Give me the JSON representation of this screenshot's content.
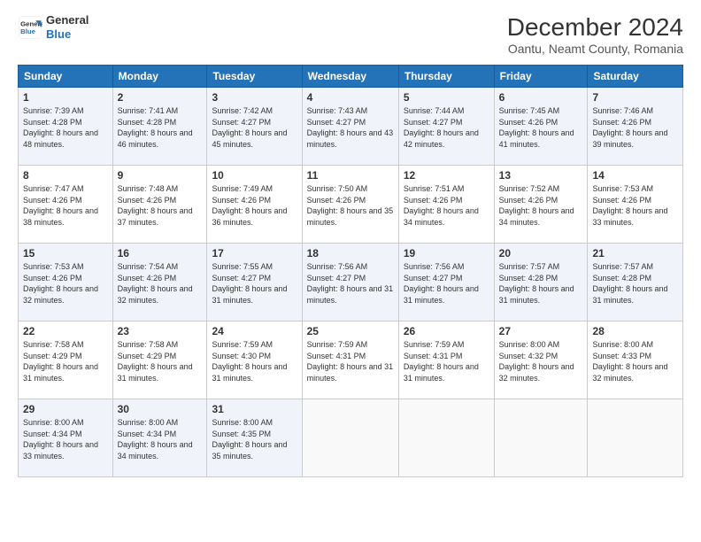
{
  "header": {
    "logo_line1": "General",
    "logo_line2": "Blue",
    "main_title": "December 2024",
    "subtitle": "Oantu, Neamt County, Romania"
  },
  "days_of_week": [
    "Sunday",
    "Monday",
    "Tuesday",
    "Wednesday",
    "Thursday",
    "Friday",
    "Saturday"
  ],
  "weeks": [
    [
      {
        "day": "1",
        "sunrise": "7:39 AM",
        "sunset": "4:28 PM",
        "daylight": "8 hours and 48 minutes."
      },
      {
        "day": "2",
        "sunrise": "7:41 AM",
        "sunset": "4:28 PM",
        "daylight": "8 hours and 46 minutes."
      },
      {
        "day": "3",
        "sunrise": "7:42 AM",
        "sunset": "4:27 PM",
        "daylight": "8 hours and 45 minutes."
      },
      {
        "day": "4",
        "sunrise": "7:43 AM",
        "sunset": "4:27 PM",
        "daylight": "8 hours and 43 minutes."
      },
      {
        "day": "5",
        "sunrise": "7:44 AM",
        "sunset": "4:27 PM",
        "daylight": "8 hours and 42 minutes."
      },
      {
        "day": "6",
        "sunrise": "7:45 AM",
        "sunset": "4:26 PM",
        "daylight": "8 hours and 41 minutes."
      },
      {
        "day": "7",
        "sunrise": "7:46 AM",
        "sunset": "4:26 PM",
        "daylight": "8 hours and 39 minutes."
      }
    ],
    [
      {
        "day": "8",
        "sunrise": "7:47 AM",
        "sunset": "4:26 PM",
        "daylight": "8 hours and 38 minutes."
      },
      {
        "day": "9",
        "sunrise": "7:48 AM",
        "sunset": "4:26 PM",
        "daylight": "8 hours and 37 minutes."
      },
      {
        "day": "10",
        "sunrise": "7:49 AM",
        "sunset": "4:26 PM",
        "daylight": "8 hours and 36 minutes."
      },
      {
        "day": "11",
        "sunrise": "7:50 AM",
        "sunset": "4:26 PM",
        "daylight": "8 hours and 35 minutes."
      },
      {
        "day": "12",
        "sunrise": "7:51 AM",
        "sunset": "4:26 PM",
        "daylight": "8 hours and 34 minutes."
      },
      {
        "day": "13",
        "sunrise": "7:52 AM",
        "sunset": "4:26 PM",
        "daylight": "8 hours and 34 minutes."
      },
      {
        "day": "14",
        "sunrise": "7:53 AM",
        "sunset": "4:26 PM",
        "daylight": "8 hours and 33 minutes."
      }
    ],
    [
      {
        "day": "15",
        "sunrise": "7:53 AM",
        "sunset": "4:26 PM",
        "daylight": "8 hours and 32 minutes."
      },
      {
        "day": "16",
        "sunrise": "7:54 AM",
        "sunset": "4:26 PM",
        "daylight": "8 hours and 32 minutes."
      },
      {
        "day": "17",
        "sunrise": "7:55 AM",
        "sunset": "4:27 PM",
        "daylight": "8 hours and 31 minutes."
      },
      {
        "day": "18",
        "sunrise": "7:56 AM",
        "sunset": "4:27 PM",
        "daylight": "8 hours and 31 minutes."
      },
      {
        "day": "19",
        "sunrise": "7:56 AM",
        "sunset": "4:27 PM",
        "daylight": "8 hours and 31 minutes."
      },
      {
        "day": "20",
        "sunrise": "7:57 AM",
        "sunset": "4:28 PM",
        "daylight": "8 hours and 31 minutes."
      },
      {
        "day": "21",
        "sunrise": "7:57 AM",
        "sunset": "4:28 PM",
        "daylight": "8 hours and 31 minutes."
      }
    ],
    [
      {
        "day": "22",
        "sunrise": "7:58 AM",
        "sunset": "4:29 PM",
        "daylight": "8 hours and 31 minutes."
      },
      {
        "day": "23",
        "sunrise": "7:58 AM",
        "sunset": "4:29 PM",
        "daylight": "8 hours and 31 minutes."
      },
      {
        "day": "24",
        "sunrise": "7:59 AM",
        "sunset": "4:30 PM",
        "daylight": "8 hours and 31 minutes."
      },
      {
        "day": "25",
        "sunrise": "7:59 AM",
        "sunset": "4:31 PM",
        "daylight": "8 hours and 31 minutes."
      },
      {
        "day": "26",
        "sunrise": "7:59 AM",
        "sunset": "4:31 PM",
        "daylight": "8 hours and 31 minutes."
      },
      {
        "day": "27",
        "sunrise": "8:00 AM",
        "sunset": "4:32 PM",
        "daylight": "8 hours and 32 minutes."
      },
      {
        "day": "28",
        "sunrise": "8:00 AM",
        "sunset": "4:33 PM",
        "daylight": "8 hours and 32 minutes."
      }
    ],
    [
      {
        "day": "29",
        "sunrise": "8:00 AM",
        "sunset": "4:34 PM",
        "daylight": "8 hours and 33 minutes."
      },
      {
        "day": "30",
        "sunrise": "8:00 AM",
        "sunset": "4:34 PM",
        "daylight": "8 hours and 34 minutes."
      },
      {
        "day": "31",
        "sunrise": "8:00 AM",
        "sunset": "4:35 PM",
        "daylight": "8 hours and 35 minutes."
      },
      null,
      null,
      null,
      null
    ]
  ]
}
